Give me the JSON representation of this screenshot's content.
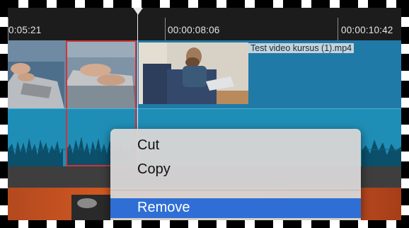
{
  "ruler": {
    "timecodes": [
      "0:05:21",
      "00:00:08:06",
      "00:00:10:42"
    ]
  },
  "clip": {
    "filename": "Test video kursus (1).mp4"
  },
  "context_menu": {
    "items": [
      {
        "label": "Cut",
        "highlighted": false
      },
      {
        "label": "Copy",
        "highlighted": false
      },
      {
        "label": "Remove",
        "highlighted": true
      }
    ]
  },
  "colors": {
    "selection_border": "#d0333a",
    "menu_highlight": "#2f6fd5",
    "video_track": "#207aa8",
    "audio_track": "#1f8eb6"
  }
}
